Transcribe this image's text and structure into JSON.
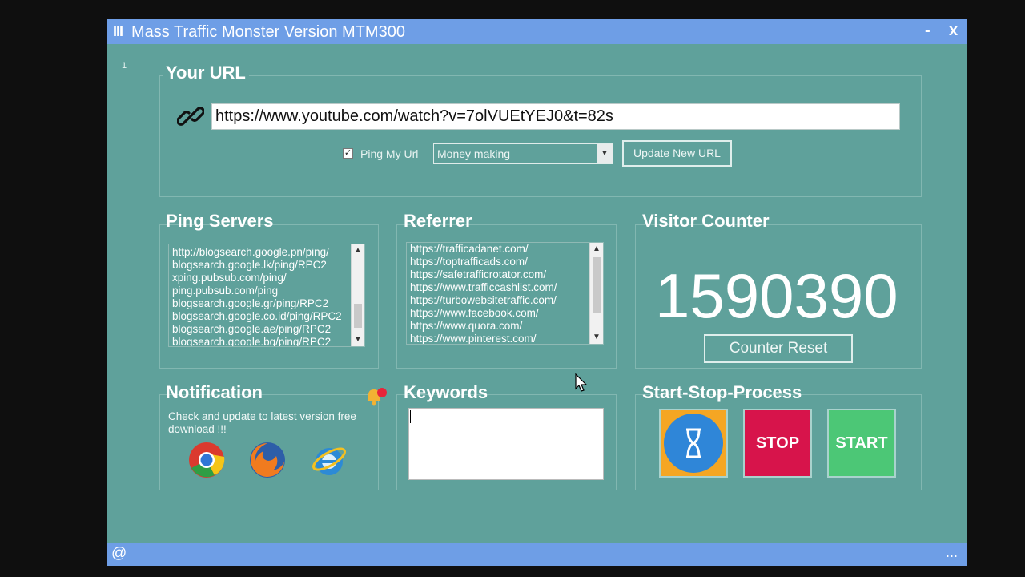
{
  "window": {
    "title": "Mass Traffic Monster Version MTM300",
    "menu_icon": "III",
    "minimize": "-",
    "close": "x",
    "corner_number": "1"
  },
  "url_section": {
    "legend": "Your URL",
    "url_value": "https://www.youtube.com/watch?v=7olVUEtYEJ0&t=82s",
    "ping_checkbox_checked": true,
    "ping_label": "Ping My Url",
    "category_selected": "Money making",
    "update_button": "Update New URL"
  },
  "ping_servers": {
    "label": "Ping Servers",
    "items": [
      "http://blogsearch.google.pn/ping/",
      "blogsearch.google.lk/ping/RPC2",
      "xping.pubsub.com/ping/",
      "ping.pubsub.com/ping",
      "blogsearch.google.gr/ping/RPC2",
      "blogsearch.google.co.id/ping/RPC2",
      "blogsearch.google.ae/ping/RPC2",
      "blogsearch.google.bg/ping/RPC2"
    ]
  },
  "referrer": {
    "label": "Referrer",
    "items": [
      "https://trafficadanet.com/",
      "https://toptrafficads.com/",
      "https://safetrafficrotator.com/",
      "https://www.trafficcashlist.com/",
      "https://turbowebsitetraffic.com/",
      "https://www.facebook.com/",
      "https://www.quora.com/",
      "https://www.pinterest.com/"
    ]
  },
  "visitor_counter": {
    "label": "Visitor Counter",
    "value": "1590390",
    "reset_button": "Counter Reset"
  },
  "notification": {
    "label": "Notification",
    "text": "Check and update to latest version free download !!!",
    "browsers": [
      "chrome-icon",
      "firefox-icon",
      "internet-explorer-icon"
    ]
  },
  "keywords": {
    "label": "Keywords",
    "value": ""
  },
  "process": {
    "label": "Start-Stop-Process",
    "stop_button": "STOP",
    "start_button": "START",
    "colors": {
      "hourglass_bg": "#f5a623",
      "hourglass_circle": "#2f86d8",
      "stop_bg": "#d7144b",
      "start_bg": "#4cc776"
    }
  },
  "statusbar": {
    "left_symbol": "@",
    "right_symbol": "..."
  },
  "colors": {
    "window_bg": "#5fa19b",
    "titlebar_bg": "#6e9ee6"
  }
}
